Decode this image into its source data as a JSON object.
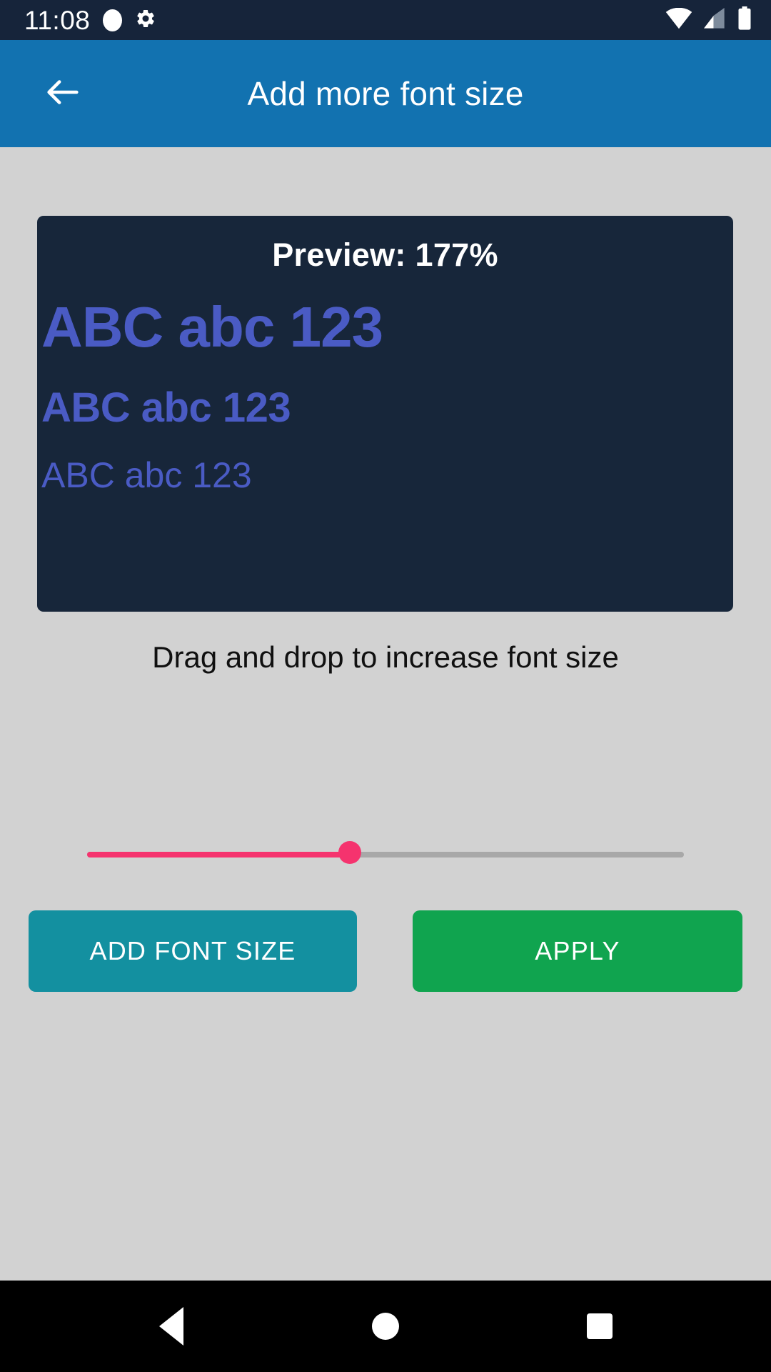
{
  "status_bar": {
    "time": "11:08",
    "icons": [
      "circle-indicator-icon",
      "gear-icon",
      "wifi-icon",
      "cellular-signal-icon",
      "battery-icon"
    ],
    "background_color": "#16243a"
  },
  "app_bar": {
    "title": "Add more font size",
    "back_icon": "arrow-left-icon",
    "background_color": "#1272b0",
    "text_color": "#ffffff"
  },
  "preview_card": {
    "title": "Preview: 177%",
    "percent": "177%",
    "background_color": "#17263a",
    "sample_color": "#4a5bc4",
    "samples": [
      {
        "text": "ABC abc 123",
        "weight": "bold",
        "relative_size": "large"
      },
      {
        "text": "ABC abc 123",
        "weight": "bold",
        "relative_size": "medium"
      },
      {
        "text": "ABC abc 123",
        "weight": "regular",
        "relative_size": "small"
      }
    ]
  },
  "slider_section": {
    "hint": "Drag and drop to increase font size",
    "value_percent": 44,
    "fill_color": "#f5336e",
    "track_color": "#a8a8a8"
  },
  "buttons": {
    "add_label": "ADD FONT SIZE",
    "add_color": "#1390a0",
    "apply_label": "APPLY",
    "apply_color": "#10a44f"
  },
  "nav_bar": {
    "back_icon": "triangle-back-icon",
    "home_icon": "circle-home-icon",
    "recents_icon": "square-recents-icon",
    "background_color": "#000000"
  }
}
